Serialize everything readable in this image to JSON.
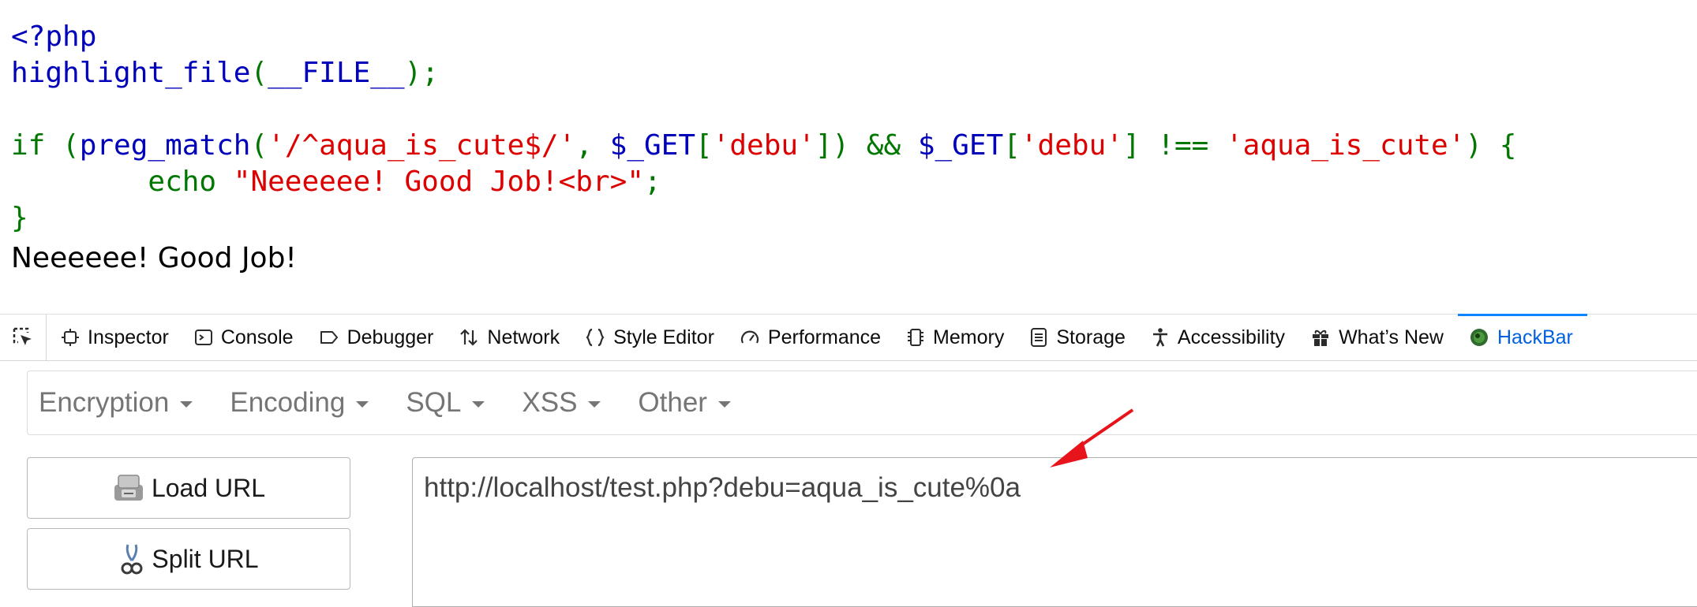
{
  "source": {
    "line1": "<?php",
    "line2_fn": "highlight_file",
    "line2_open": "(",
    "line2_const": "__FILE__",
    "line2_close": ");",
    "line4_if": "if (",
    "line4_fn": "preg_match",
    "line4_p1": "(",
    "line4_pattern": "'/^aqua_is_cute$/'",
    "line4_comma": ", ",
    "line4_get1": "$_GET",
    "line4_b1": "[",
    "line4_key1": "'debu'",
    "line4_b2": "])",
    "line4_and": " && ",
    "line4_get2": "$_GET",
    "line4_b3": "[",
    "line4_key2": "'debu'",
    "line4_b4": "] !== ",
    "line4_val": "'aqua_is_cute'",
    "line4_end": ") {",
    "line5_indent": "        ",
    "line5_echo": "echo ",
    "line5_str": "\"Neeeeee! Good Job!<br>\"",
    "line5_semi": ";",
    "line6": "}"
  },
  "output_text": "Neeeeee! Good Job!",
  "devtools": {
    "tabs": [
      {
        "label": "Inspector",
        "icon": "inspector-icon"
      },
      {
        "label": "Console",
        "icon": "console-icon"
      },
      {
        "label": "Debugger",
        "icon": "debugger-icon"
      },
      {
        "label": "Network",
        "icon": "network-icon"
      },
      {
        "label": "Style Editor",
        "icon": "style-editor-icon"
      },
      {
        "label": "Performance",
        "icon": "performance-icon"
      },
      {
        "label": "Memory",
        "icon": "memory-icon"
      },
      {
        "label": "Storage",
        "icon": "storage-icon"
      },
      {
        "label": "Accessibility",
        "icon": "accessibility-icon"
      },
      {
        "label": "What’s New",
        "icon": "whats-new-icon"
      },
      {
        "label": "HackBar",
        "icon": "hackbar-icon"
      }
    ],
    "selected_tab": "HackBar"
  },
  "hackbar": {
    "menus": [
      "Encryption",
      "Encoding",
      "SQL",
      "XSS",
      "Other"
    ],
    "load_url_label": "Load URL",
    "split_url_label": "Split URL",
    "url_value": "http://localhost/test.php?debu=aqua_is_cute%0a"
  },
  "colors": {
    "php_keyword": "#007700",
    "php_default": "#0000bb",
    "php_string": "#dd0000",
    "selected_tab": "#0060df",
    "annotation_arrow": "#e8141b"
  }
}
